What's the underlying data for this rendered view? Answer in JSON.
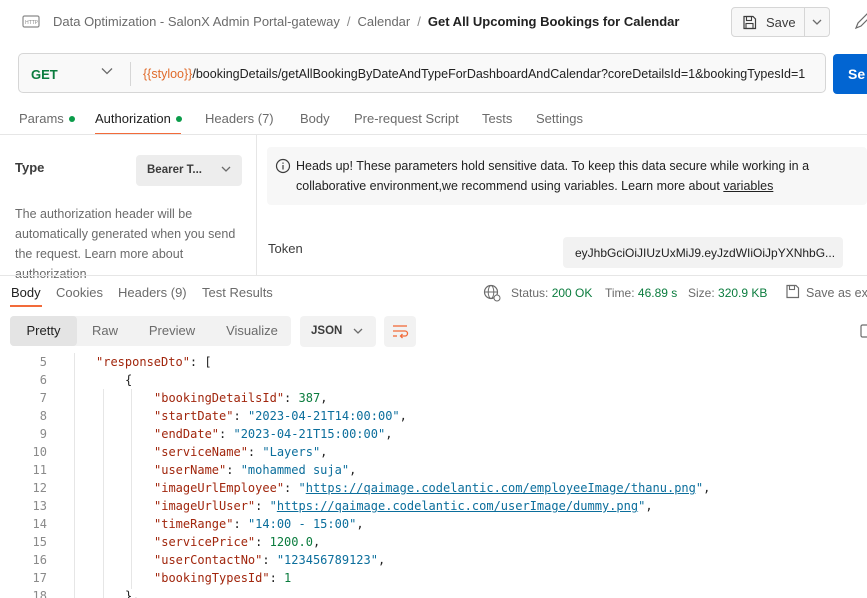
{
  "header": {
    "breadcrumb": [
      "Data Optimization - SalonX Admin Portal-gateway",
      "Calendar"
    ],
    "title": "Get All Upcoming Bookings for Calendar",
    "save_label": "Save"
  },
  "request": {
    "method": "GET",
    "url_variable": "{{styloo}}",
    "url_path": "/bookingDetails/getAllBookingByDateAndTypeForDashboardAndCalendar?coreDetailsId=1&bookingTypesId=1",
    "send_label": "Se"
  },
  "request_tabs": [
    {
      "label": "Params",
      "dot": true
    },
    {
      "label": "Authorization",
      "dot": true
    },
    {
      "label": "Headers (7)",
      "dot": false
    },
    {
      "label": "Body",
      "dot": false
    },
    {
      "label": "Pre-request Script",
      "dot": false
    },
    {
      "label": "Tests",
      "dot": false
    },
    {
      "label": "Settings",
      "dot": false
    }
  ],
  "auth": {
    "type_label": "Type",
    "type_value": "Bearer T...",
    "description": "The authorization header will be automatically generated when you send the request. Learn more about authorization",
    "notice": "Heads up! These parameters hold sensitive data. To keep this data secure while working in a collaborative environment,we recommend using variables. Learn more about ",
    "notice_link": "variables",
    "token_label": "Token",
    "token_value": "eyJhbGciOiJIUzUxMiJ9.eyJzdWIiOiJpYXNhbG..."
  },
  "response": {
    "tabs": [
      "Body",
      "Cookies",
      "Headers (9)",
      "Test Results"
    ],
    "status_label": "Status:",
    "status_value": "200 OK",
    "time_label": "Time:",
    "time_value": "46.89 s",
    "size_label": "Size:",
    "size_value": "320.9 KB",
    "save_as": "Save as ex",
    "formats": [
      "Pretty",
      "Raw",
      "Preview",
      "Visualize"
    ],
    "language": "JSON"
  },
  "code_lines": [
    {
      "no": "5",
      "key": "responseDto",
      "val": "[",
      "type": "open"
    },
    {
      "no": "6",
      "val": "{",
      "type": "brace"
    },
    {
      "no": "7",
      "key": "bookingDetailsId",
      "val": "387",
      "type": "num"
    },
    {
      "no": "8",
      "key": "startDate",
      "val": "2023-04-21T14:00:00",
      "type": "str"
    },
    {
      "no": "9",
      "key": "endDate",
      "val": "2023-04-21T15:00:00",
      "type": "str"
    },
    {
      "no": "10",
      "key": "serviceName",
      "val": "Layers",
      "type": "str"
    },
    {
      "no": "11",
      "key": "userName",
      "val": "mohammed suja",
      "type": "str"
    },
    {
      "no": "12",
      "key": "imageUrlEmployee",
      "val": "https://qaimage.codelantic.com/employeeImage/thanu.png",
      "type": "url"
    },
    {
      "no": "13",
      "key": "imageUrlUser",
      "val": "https://qaimage.codelantic.com/userImage/dummy.png",
      "type": "url"
    },
    {
      "no": "14",
      "key": "timeRange",
      "val": "14:00 - 15:00",
      "type": "str"
    },
    {
      "no": "15",
      "key": "servicePrice",
      "val": "1200.0",
      "type": "num"
    },
    {
      "no": "16",
      "key": "userContactNo",
      "val": "123456789123",
      "type": "str"
    },
    {
      "no": "17",
      "key": "bookingTypesId",
      "val": "1",
      "type": "numlast"
    },
    {
      "no": "18",
      "val": "},",
      "type": "close"
    }
  ],
  "colors": {
    "accent": "#f26b3a",
    "send": "#0265d2",
    "status_ok": "#0b7c3e",
    "method_get": "#0b7c3e"
  }
}
